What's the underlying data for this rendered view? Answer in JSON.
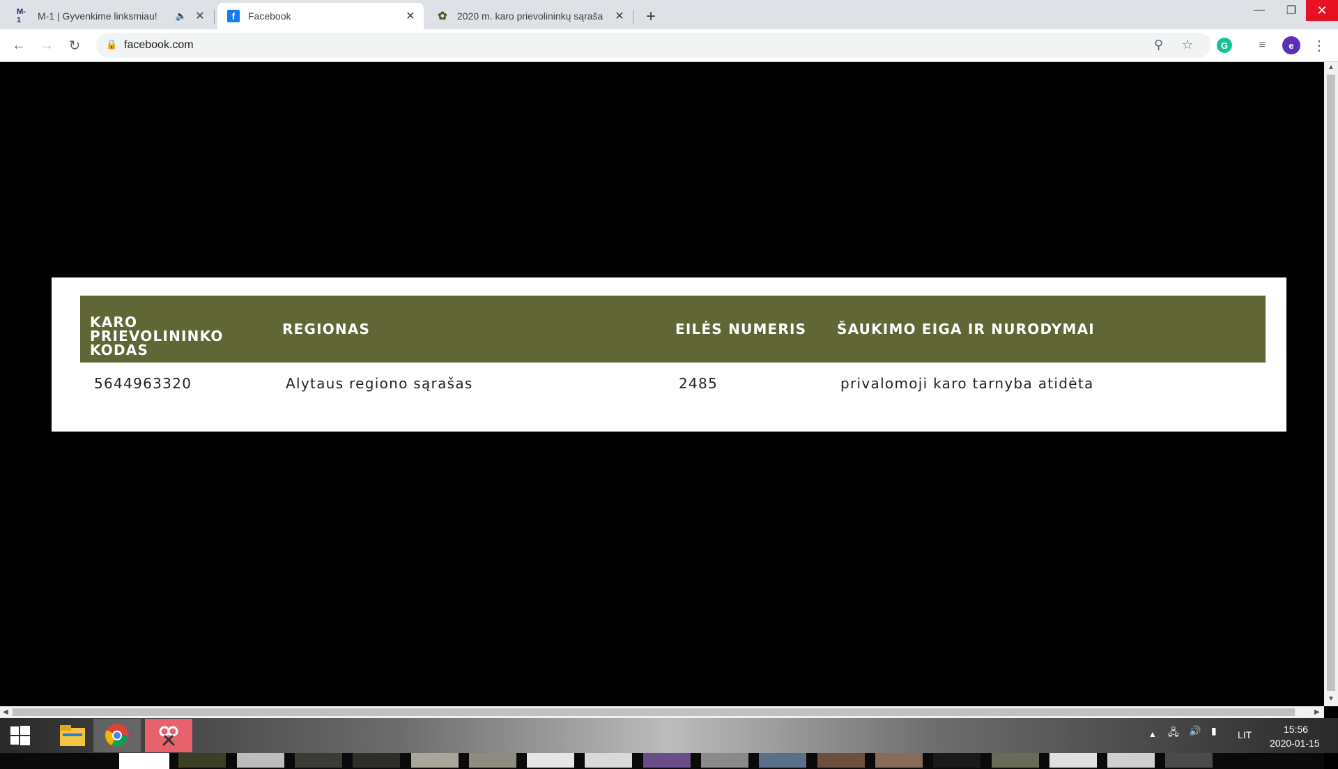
{
  "browser": {
    "tabs": [
      {
        "favicon": "M-1",
        "title": "M-1 | Gyvenkime linksmiau!",
        "muted": true
      },
      {
        "favicon": "f",
        "title": "Facebook"
      },
      {
        "favicon": "leaf-icon",
        "title": "2020 m. karo prievolininkų sąraša"
      }
    ],
    "url": "facebook.com",
    "profile_initial": "e"
  },
  "table": {
    "headers": [
      "KARO PRIEVOLININKO KODAS",
      "REGIONAS",
      "EILĖS NUMERIS",
      "ŠAUKIMO EIGA IR NURODYMAI"
    ],
    "row": [
      "5644963320",
      "Alytaus regiono sąrašas",
      "2485",
      "privalomoji karo tarnyba atidėta"
    ],
    "header_color": "#616636"
  },
  "thumbnail_count": 19,
  "taskbar": {
    "language": "LIT",
    "time": "15:56",
    "date": "2020-01-15"
  }
}
